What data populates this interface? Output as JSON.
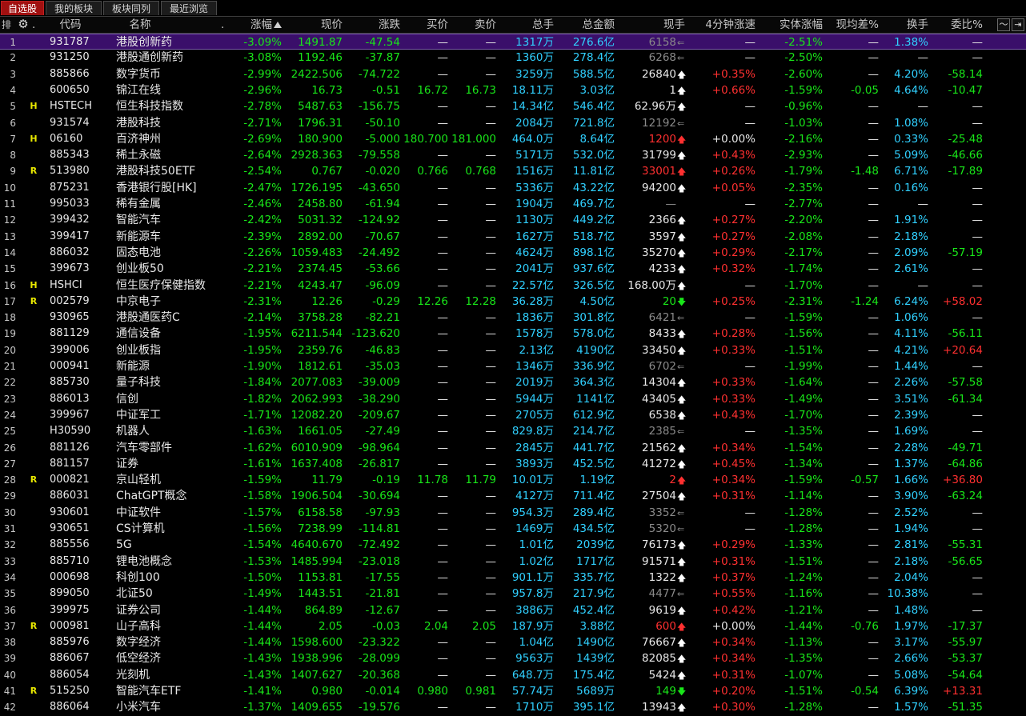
{
  "tabs": [
    "自选股",
    "我的板块",
    "板块同列",
    "最近浏览"
  ],
  "active_tab": 0,
  "header": {
    "rank": "排",
    "gear_icon": "gear-icon",
    "dot": ".",
    "code": "代码",
    "name": "名称",
    "name_dot": ".",
    "chg_pct": "涨幅",
    "price": "现价",
    "chg": "涨跌",
    "bid": "买价",
    "ask": "卖价",
    "vol": "总手",
    "amount": "总金额",
    "cur_vol": "现手",
    "spd4": "4分钟涨速",
    "body_chg": "实体涨幅",
    "avg_diff": "现均差%",
    "turnover": "换手",
    "ratio": "委比%",
    "chart_icon": "chart-icon",
    "exit_icon": "exit-icon"
  },
  "colors": {
    "green": "#19e619",
    "red": "#ff3030",
    "cyan": "#30d0ff",
    "selected": "#3a0f6a"
  },
  "rows": [
    {
      "i": "1",
      "f": "",
      "code": "931787",
      "name": "港股创新药",
      "pct": "-3.09%",
      "price": "1491.87",
      "chg": "-47.54",
      "bid": "—",
      "ask": "—",
      "vol": "1317万",
      "amt": "276.6亿",
      "cur": "6158",
      "dir": "flat",
      "spd": "—",
      "body": "-2.51%",
      "avg": "—",
      "turn": "1.38%",
      "ratio": "—"
    },
    {
      "i": "2",
      "f": "",
      "code": "931250",
      "name": "港股通创新药",
      "pct": "-3.08%",
      "price": "1192.46",
      "chg": "-37.87",
      "bid": "—",
      "ask": "—",
      "vol": "1360万",
      "amt": "278.4亿",
      "cur": "6268",
      "dir": "flat",
      "spd": "—",
      "body": "-2.50%",
      "avg": "—",
      "turn": "—",
      "ratio": "—"
    },
    {
      "i": "3",
      "f": "",
      "code": "885866",
      "name": "数字货币",
      "pct": "-2.99%",
      "price": "2422.506",
      "chg": "-74.722",
      "bid": "—",
      "ask": "—",
      "vol": "3259万",
      "amt": "588.5亿",
      "cur": "26840",
      "dir": "up",
      "spd": "+0.35%",
      "body": "-2.60%",
      "avg": "—",
      "turn": "4.20%",
      "ratio": "-58.14"
    },
    {
      "i": "4",
      "f": "",
      "code": "600650",
      "name": "锦江在线",
      "pct": "-2.96%",
      "price": "16.73",
      "chg": "-0.51",
      "bid": "16.72",
      "ask": "16.73",
      "vol": "18.11万",
      "amt": "3.03亿",
      "cur": "1",
      "dir": "up",
      "spd": "+0.66%",
      "body": "-1.59%",
      "avg": "-0.05",
      "turn": "4.64%",
      "ratio": "-10.47"
    },
    {
      "i": "5",
      "f": "H",
      "code": "HSTECH",
      "name": "恒生科技指数",
      "pct": "-2.78%",
      "price": "5487.63",
      "chg": "-156.75",
      "bid": "—",
      "ask": "—",
      "vol": "14.34亿",
      "amt": "546.4亿",
      "cur": "62.96万",
      "dir": "up",
      "spd": "—",
      "body": "-0.96%",
      "avg": "—",
      "turn": "—",
      "ratio": "—"
    },
    {
      "i": "6",
      "f": "",
      "code": "931574",
      "name": "港股科技",
      "pct": "-2.71%",
      "price": "1796.31",
      "chg": "-50.10",
      "bid": "—",
      "ask": "—",
      "vol": "2084万",
      "amt": "721.8亿",
      "cur": "12192",
      "dir": "flat",
      "spd": "—",
      "body": "-1.03%",
      "avg": "—",
      "turn": "1.08%",
      "ratio": "—"
    },
    {
      "i": "7",
      "f": "H",
      "code": "06160",
      "name": "百济神州",
      "pct": "-2.69%",
      "price": "180.900",
      "chg": "-5.000",
      "bid": "180.700",
      "ask": "181.000",
      "vol": "464.0万",
      "amt": "8.64亿",
      "cur": "1200",
      "dir": "upred",
      "spd": "+0.00%",
      "body": "-2.16%",
      "avg": "—",
      "turn": "0.33%",
      "ratio": "-25.48"
    },
    {
      "i": "8",
      "f": "",
      "code": "885343",
      "name": "稀土永磁",
      "pct": "-2.64%",
      "price": "2928.363",
      "chg": "-79.558",
      "bid": "—",
      "ask": "—",
      "vol": "5171万",
      "amt": "532.0亿",
      "cur": "31799",
      "dir": "up",
      "spd": "+0.43%",
      "body": "-2.93%",
      "avg": "—",
      "turn": "5.09%",
      "ratio": "-46.66"
    },
    {
      "i": "9",
      "f": "R",
      "code": "513980",
      "name": "港股科技50ETF",
      "pct": "-2.54%",
      "price": "0.767",
      "chg": "-0.020",
      "bid": "0.766",
      "ask": "0.768",
      "vol": "1516万",
      "amt": "11.81亿",
      "cur": "33001",
      "dir": "upred",
      "spd": "+0.26%",
      "body": "-1.79%",
      "avg": "-1.48",
      "turn": "6.71%",
      "ratio": "-17.89"
    },
    {
      "i": "10",
      "f": "",
      "code": "875231",
      "name": "香港银行股[HK]",
      "pct": "-2.47%",
      "price": "1726.195",
      "chg": "-43.650",
      "bid": "—",
      "ask": "—",
      "vol": "5336万",
      "amt": "43.22亿",
      "cur": "94200",
      "dir": "up",
      "spd": "+0.05%",
      "body": "-2.35%",
      "avg": "—",
      "turn": "0.16%",
      "ratio": "—"
    },
    {
      "i": "11",
      "f": "",
      "code": "995033",
      "name": "稀有金属",
      "pct": "-2.46%",
      "price": "2458.80",
      "chg": "-61.94",
      "bid": "—",
      "ask": "—",
      "vol": "1904万",
      "amt": "469.7亿",
      "cur": "—",
      "dir": "none",
      "spd": "—",
      "body": "-2.77%",
      "avg": "—",
      "turn": "—",
      "ratio": "—"
    },
    {
      "i": "12",
      "f": "",
      "code": "399432",
      "name": "智能汽车",
      "pct": "-2.42%",
      "price": "5031.32",
      "chg": "-124.92",
      "bid": "—",
      "ask": "—",
      "vol": "1130万",
      "amt": "449.2亿",
      "cur": "2366",
      "dir": "up",
      "spd": "+0.27%",
      "body": "-2.20%",
      "avg": "—",
      "turn": "1.91%",
      "ratio": "—"
    },
    {
      "i": "13",
      "f": "",
      "code": "399417",
      "name": "新能源车",
      "pct": "-2.39%",
      "price": "2892.00",
      "chg": "-70.67",
      "bid": "—",
      "ask": "—",
      "vol": "1627万",
      "amt": "518.7亿",
      "cur": "3597",
      "dir": "up",
      "spd": "+0.27%",
      "body": "-2.08%",
      "avg": "—",
      "turn": "2.18%",
      "ratio": "—"
    },
    {
      "i": "14",
      "f": "",
      "code": "886032",
      "name": "固态电池",
      "pct": "-2.26%",
      "price": "1059.483",
      "chg": "-24.492",
      "bid": "—",
      "ask": "—",
      "vol": "4624万",
      "amt": "898.1亿",
      "cur": "35270",
      "dir": "up",
      "spd": "+0.29%",
      "body": "-2.17%",
      "avg": "—",
      "turn": "2.09%",
      "ratio": "-57.19"
    },
    {
      "i": "15",
      "f": "",
      "code": "399673",
      "name": "创业板50",
      "pct": "-2.21%",
      "price": "2374.45",
      "chg": "-53.66",
      "bid": "—",
      "ask": "—",
      "vol": "2041万",
      "amt": "937.6亿",
      "cur": "4233",
      "dir": "up",
      "spd": "+0.32%",
      "body": "-1.74%",
      "avg": "—",
      "turn": "2.61%",
      "ratio": "—"
    },
    {
      "i": "16",
      "f": "H",
      "code": "HSHCI",
      "name": "恒生医疗保健指数",
      "pct": "-2.21%",
      "price": "4243.47",
      "chg": "-96.09",
      "bid": "—",
      "ask": "—",
      "vol": "22.57亿",
      "amt": "326.5亿",
      "cur": "168.00万",
      "dir": "up",
      "spd": "—",
      "body": "-1.70%",
      "avg": "—",
      "turn": "—",
      "ratio": "—"
    },
    {
      "i": "17",
      "f": "R",
      "code": "002579",
      "name": "中京电子",
      "pct": "-2.31%",
      "price": "12.26",
      "chg": "-0.29",
      "bid": "12.26",
      "ask": "12.28",
      "vol": "36.28万",
      "amt": "4.50亿",
      "cur": "20",
      "dir": "downgreen",
      "spd": "+0.25%",
      "body": "-2.31%",
      "avg": "-1.24",
      "turn": "6.24%",
      "ratio": "+58.02"
    },
    {
      "i": "18",
      "f": "",
      "code": "930965",
      "name": "港股通医药C",
      "pct": "-2.14%",
      "price": "3758.28",
      "chg": "-82.21",
      "bid": "—",
      "ask": "—",
      "vol": "1836万",
      "amt": "301.8亿",
      "cur": "6421",
      "dir": "flat",
      "spd": "—",
      "body": "-1.59%",
      "avg": "—",
      "turn": "1.06%",
      "ratio": "—"
    },
    {
      "i": "19",
      "f": "",
      "code": "881129",
      "name": "通信设备",
      "pct": "-1.95%",
      "price": "6211.544",
      "chg": "-123.620",
      "bid": "—",
      "ask": "—",
      "vol": "1578万",
      "amt": "578.0亿",
      "cur": "8433",
      "dir": "up",
      "spd": "+0.28%",
      "body": "-1.56%",
      "avg": "—",
      "turn": "4.11%",
      "ratio": "-56.11"
    },
    {
      "i": "20",
      "f": "",
      "code": "399006",
      "name": "创业板指",
      "pct": "-1.95%",
      "price": "2359.76",
      "chg": "-46.83",
      "bid": "—",
      "ask": "—",
      "vol": "2.13亿",
      "amt": "4190亿",
      "cur": "33450",
      "dir": "up",
      "spd": "+0.33%",
      "body": "-1.51%",
      "avg": "—",
      "turn": "4.21%",
      "ratio": "+20.64"
    },
    {
      "i": "21",
      "f": "",
      "code": "000941",
      "name": "新能源",
      "pct": "-1.90%",
      "price": "1812.61",
      "chg": "-35.03",
      "bid": "—",
      "ask": "—",
      "vol": "1346万",
      "amt": "336.9亿",
      "cur": "6702",
      "dir": "flat",
      "spd": "—",
      "body": "-1.99%",
      "avg": "—",
      "turn": "1.44%",
      "ratio": "—"
    },
    {
      "i": "22",
      "f": "",
      "code": "885730",
      "name": "量子科技",
      "pct": "-1.84%",
      "price": "2077.083",
      "chg": "-39.009",
      "bid": "—",
      "ask": "—",
      "vol": "2019万",
      "amt": "364.3亿",
      "cur": "14304",
      "dir": "up",
      "spd": "+0.33%",
      "body": "-1.64%",
      "avg": "—",
      "turn": "2.26%",
      "ratio": "-57.58"
    },
    {
      "i": "23",
      "f": "",
      "code": "886013",
      "name": "信创",
      "pct": "-1.82%",
      "price": "2062.993",
      "chg": "-38.290",
      "bid": "—",
      "ask": "—",
      "vol": "5944万",
      "amt": "1141亿",
      "cur": "43405",
      "dir": "up",
      "spd": "+0.33%",
      "body": "-1.49%",
      "avg": "—",
      "turn": "3.51%",
      "ratio": "-61.34"
    },
    {
      "i": "24",
      "f": "",
      "code": "399967",
      "name": "中证军工",
      "pct": "-1.71%",
      "price": "12082.20",
      "chg": "-209.67",
      "bid": "—",
      "ask": "—",
      "vol": "2705万",
      "amt": "612.9亿",
      "cur": "6538",
      "dir": "up",
      "spd": "+0.43%",
      "body": "-1.70%",
      "avg": "—",
      "turn": "2.39%",
      "ratio": "—"
    },
    {
      "i": "25",
      "f": "",
      "code": "H30590",
      "name": "机器人",
      "pct": "-1.63%",
      "price": "1661.05",
      "chg": "-27.49",
      "bid": "—",
      "ask": "—",
      "vol": "829.8万",
      "amt": "214.7亿",
      "cur": "2385",
      "dir": "flat",
      "spd": "—",
      "body": "-1.35%",
      "avg": "—",
      "turn": "1.69%",
      "ratio": "—"
    },
    {
      "i": "26",
      "f": "",
      "code": "881126",
      "name": "汽车零部件",
      "pct": "-1.62%",
      "price": "6010.909",
      "chg": "-98.964",
      "bid": "—",
      "ask": "—",
      "vol": "2845万",
      "amt": "441.7亿",
      "cur": "21562",
      "dir": "up",
      "spd": "+0.34%",
      "body": "-1.54%",
      "avg": "—",
      "turn": "2.28%",
      "ratio": "-49.71"
    },
    {
      "i": "27",
      "f": "",
      "code": "881157",
      "name": "证券",
      "pct": "-1.61%",
      "price": "1637.408",
      "chg": "-26.817",
      "bid": "—",
      "ask": "—",
      "vol": "3893万",
      "amt": "452.5亿",
      "cur": "41272",
      "dir": "up",
      "spd": "+0.45%",
      "body": "-1.34%",
      "avg": "—",
      "turn": "1.37%",
      "ratio": "-64.86"
    },
    {
      "i": "28",
      "f": "R",
      "code": "000821",
      "name": "京山轻机",
      "pct": "-1.59%",
      "price": "11.79",
      "chg": "-0.19",
      "bid": "11.78",
      "ask": "11.79",
      "vol": "10.01万",
      "amt": "1.19亿",
      "cur": "2",
      "dir": "upred",
      "spd": "+0.34%",
      "body": "-1.59%",
      "avg": "-0.57",
      "turn": "1.66%",
      "ratio": "+36.80"
    },
    {
      "i": "29",
      "f": "",
      "code": "886031",
      "name": "ChatGPT概念",
      "pct": "-1.58%",
      "price": "1906.504",
      "chg": "-30.694",
      "bid": "—",
      "ask": "—",
      "vol": "4127万",
      "amt": "711.4亿",
      "cur": "27504",
      "dir": "up",
      "spd": "+0.31%",
      "body": "-1.14%",
      "avg": "—",
      "turn": "3.90%",
      "ratio": "-63.24"
    },
    {
      "i": "30",
      "f": "",
      "code": "930601",
      "name": "中证软件",
      "pct": "-1.57%",
      "price": "6158.58",
      "chg": "-97.93",
      "bid": "—",
      "ask": "—",
      "vol": "954.3万",
      "amt": "289.4亿",
      "cur": "3352",
      "dir": "flat",
      "spd": "—",
      "body": "-1.28%",
      "avg": "—",
      "turn": "2.52%",
      "ratio": "—"
    },
    {
      "i": "31",
      "f": "",
      "code": "930651",
      "name": "CS计算机",
      "pct": "-1.56%",
      "price": "7238.99",
      "chg": "-114.81",
      "bid": "—",
      "ask": "—",
      "vol": "1469万",
      "amt": "434.5亿",
      "cur": "5320",
      "dir": "flat",
      "spd": "—",
      "body": "-1.28%",
      "avg": "—",
      "turn": "1.94%",
      "ratio": "—"
    },
    {
      "i": "32",
      "f": "",
      "code": "885556",
      "name": "5G",
      "pct": "-1.54%",
      "price": "4640.670",
      "chg": "-72.492",
      "bid": "—",
      "ask": "—",
      "vol": "1.01亿",
      "amt": "2039亿",
      "cur": "76173",
      "dir": "up",
      "spd": "+0.29%",
      "body": "-1.33%",
      "avg": "—",
      "turn": "2.81%",
      "ratio": "-55.31"
    },
    {
      "i": "33",
      "f": "",
      "code": "885710",
      "name": "锂电池概念",
      "pct": "-1.53%",
      "price": "1485.994",
      "chg": "-23.018",
      "bid": "—",
      "ask": "—",
      "vol": "1.02亿",
      "amt": "1717亿",
      "cur": "91571",
      "dir": "up",
      "spd": "+0.31%",
      "body": "-1.51%",
      "avg": "—",
      "turn": "2.18%",
      "ratio": "-56.65"
    },
    {
      "i": "34",
      "f": "",
      "code": "000698",
      "name": "科创100",
      "pct": "-1.50%",
      "price": "1153.81",
      "chg": "-17.55",
      "bid": "—",
      "ask": "—",
      "vol": "901.1万",
      "amt": "335.7亿",
      "cur": "1322",
      "dir": "up",
      "spd": "+0.37%",
      "body": "-1.24%",
      "avg": "—",
      "turn": "2.04%",
      "ratio": "—"
    },
    {
      "i": "35",
      "f": "",
      "code": "899050",
      "name": "北证50",
      "pct": "-1.49%",
      "price": "1443.51",
      "chg": "-21.81",
      "bid": "—",
      "ask": "—",
      "vol": "957.8万",
      "amt": "217.9亿",
      "cur": "4477",
      "dir": "flat",
      "spd": "+0.55%",
      "body": "-1.16%",
      "avg": "—",
      "turn": "10.38%",
      "ratio": "—"
    },
    {
      "i": "36",
      "f": "",
      "code": "399975",
      "name": "证券公司",
      "pct": "-1.44%",
      "price": "864.89",
      "chg": "-12.67",
      "bid": "—",
      "ask": "—",
      "vol": "3886万",
      "amt": "452.4亿",
      "cur": "9619",
      "dir": "up",
      "spd": "+0.42%",
      "body": "-1.21%",
      "avg": "—",
      "turn": "1.48%",
      "ratio": "—"
    },
    {
      "i": "37",
      "f": "R",
      "code": "000981",
      "name": "山子高科",
      "pct": "-1.44%",
      "price": "2.05",
      "chg": "-0.03",
      "bid": "2.04",
      "ask": "2.05",
      "vol": "187.9万",
      "amt": "3.88亿",
      "cur": "600",
      "dir": "upred",
      "spd": "+0.00%",
      "body": "-1.44%",
      "avg": "-0.76",
      "turn": "1.97%",
      "ratio": "-17.37"
    },
    {
      "i": "38",
      "f": "",
      "code": "885976",
      "name": "数字经济",
      "pct": "-1.44%",
      "price": "1598.600",
      "chg": "-23.322",
      "bid": "—",
      "ask": "—",
      "vol": "1.04亿",
      "amt": "1490亿",
      "cur": "76667",
      "dir": "up",
      "spd": "+0.34%",
      "body": "-1.13%",
      "avg": "—",
      "turn": "3.17%",
      "ratio": "-55.97"
    },
    {
      "i": "39",
      "f": "",
      "code": "886067",
      "name": "低空经济",
      "pct": "-1.43%",
      "price": "1938.996",
      "chg": "-28.099",
      "bid": "—",
      "ask": "—",
      "vol": "9563万",
      "amt": "1439亿",
      "cur": "82085",
      "dir": "up",
      "spd": "+0.34%",
      "body": "-1.35%",
      "avg": "—",
      "turn": "2.66%",
      "ratio": "-53.37"
    },
    {
      "i": "40",
      "f": "",
      "code": "886054",
      "name": "光刻机",
      "pct": "-1.43%",
      "price": "1407.627",
      "chg": "-20.368",
      "bid": "—",
      "ask": "—",
      "vol": "648.7万",
      "amt": "175.4亿",
      "cur": "5424",
      "dir": "up",
      "spd": "+0.31%",
      "body": "-1.07%",
      "avg": "—",
      "turn": "5.08%",
      "ratio": "-54.64"
    },
    {
      "i": "41",
      "f": "R",
      "code": "515250",
      "name": "智能汽车ETF",
      "pct": "-1.41%",
      "price": "0.980",
      "chg": "-0.014",
      "bid": "0.980",
      "ask": "0.981",
      "vol": "57.74万",
      "amt": "5689万",
      "cur": "149",
      "dir": "downgreen",
      "spd": "+0.20%",
      "body": "-1.51%",
      "avg": "-0.54",
      "turn": "6.39%",
      "ratio": "+13.31"
    },
    {
      "i": "42",
      "f": "",
      "code": "886064",
      "name": "小米汽车",
      "pct": "-1.37%",
      "price": "1409.655",
      "chg": "-19.576",
      "bid": "—",
      "ask": "—",
      "vol": "1710万",
      "amt": "395.1亿",
      "cur": "13943",
      "dir": "up",
      "spd": "+0.30%",
      "body": "-1.28%",
      "avg": "—",
      "turn": "1.57%",
      "ratio": "-51.35"
    }
  ]
}
